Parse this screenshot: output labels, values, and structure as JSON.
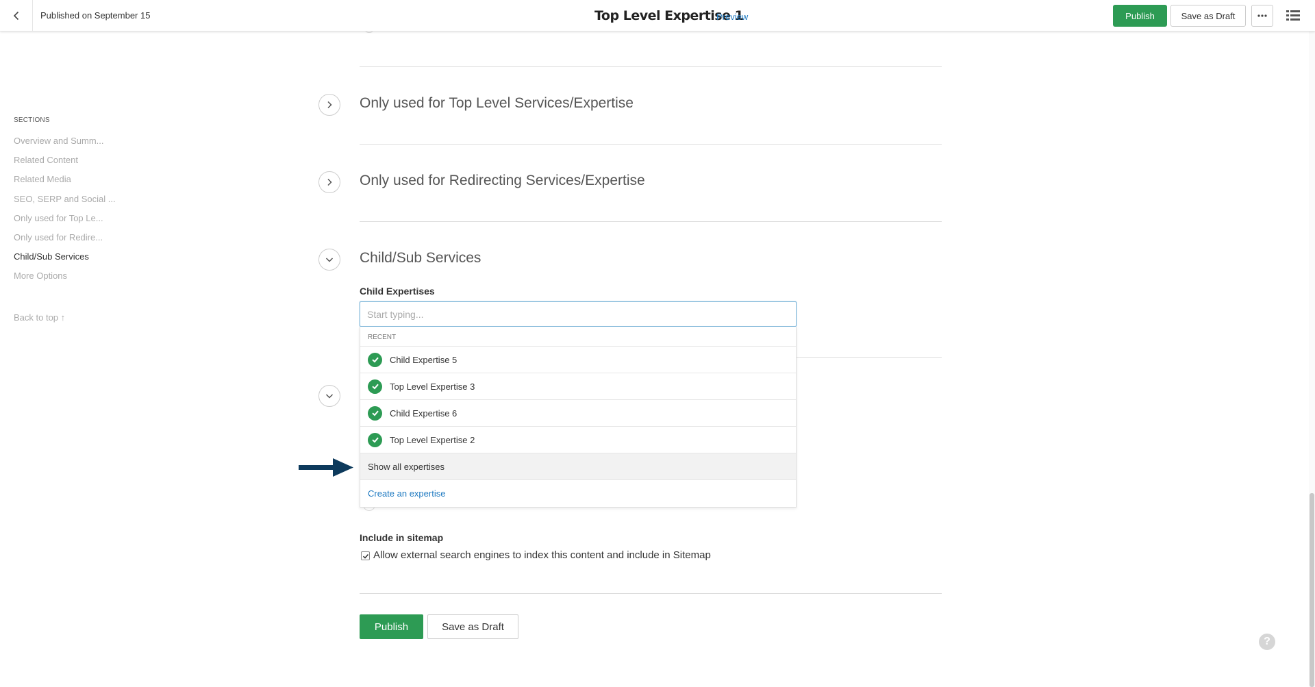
{
  "topbar": {
    "status": "Published on September 15",
    "title": "Top Level Expertise 1",
    "preview": "Preview",
    "publish": "Publish",
    "save_draft": "Save as Draft"
  },
  "sidebar": {
    "heading": "SECTIONS",
    "items": [
      {
        "label": "Overview and Summ..."
      },
      {
        "label": "Related Content"
      },
      {
        "label": "Related Media"
      },
      {
        "label": "SEO, SERP and Social ..."
      },
      {
        "label": "Only used for Top Le..."
      },
      {
        "label": "Only used for Redire..."
      },
      {
        "label": "Child/Sub Services"
      },
      {
        "label": "More Options"
      }
    ],
    "active_item": "Child/Sub Services",
    "back_to_top": "Back to top ↑"
  },
  "main": {
    "sections": [
      {
        "title": "Only used for Top Level Services/Expertise",
        "expanded": false
      },
      {
        "title": "Only used for Redirecting Services/Expertise",
        "expanded": false
      },
      {
        "title": "Child/Sub Services",
        "expanded": true
      }
    ],
    "child_expertises": {
      "label": "Child Expertises",
      "placeholder": "Start typing...",
      "value": ""
    },
    "dropdown": {
      "recent_label": "RECENT",
      "items": [
        {
          "label": "Child Expertise 5",
          "selected": true
        },
        {
          "label": "Top Level Expertise 3",
          "selected": true
        },
        {
          "label": "Child Expertise 6",
          "selected": true
        },
        {
          "label": "Top Level Expertise 2",
          "selected": true
        }
      ],
      "show_all": "Show all expertises",
      "create": "Create an expertise"
    },
    "sitemap": {
      "label": "Include in sitemap",
      "checkbox_label": "Allow external search engines to index this content and include in Sitemap",
      "checked": true
    },
    "publish": "Publish",
    "save_draft": "Save as Draft"
  },
  "colors": {
    "accent_green": "#2d9b54",
    "link_blue": "#1f7ac1",
    "annotation_arrow": "#0d3a5c"
  }
}
